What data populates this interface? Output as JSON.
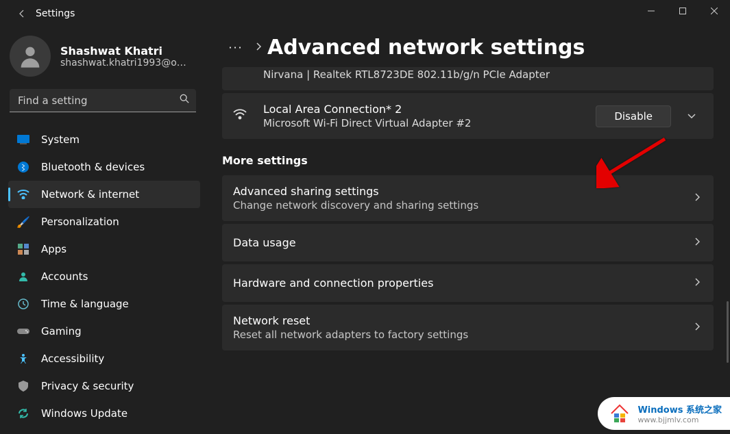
{
  "app_title": "Settings",
  "user": {
    "name": "Shashwat Khatri",
    "email": "shashwat.khatri1993@o…"
  },
  "search": {
    "placeholder": "Find a setting"
  },
  "sidebar": {
    "items": [
      {
        "label": "System",
        "icon": "💻",
        "selected": false
      },
      {
        "label": "Bluetooth & devices",
        "icon": "bt",
        "selected": false
      },
      {
        "label": "Network & internet",
        "icon": "wifi",
        "selected": true
      },
      {
        "label": "Personalization",
        "icon": "🖌️",
        "selected": false
      },
      {
        "label": "Apps",
        "icon": "apps",
        "selected": false
      },
      {
        "label": "Accounts",
        "icon": "👤",
        "selected": false
      },
      {
        "label": "Time & language",
        "icon": "🕒",
        "selected": false
      },
      {
        "label": "Gaming",
        "icon": "🎮",
        "selected": false
      },
      {
        "label": "Accessibility",
        "icon": "♿",
        "selected": false
      },
      {
        "label": "Privacy & security",
        "icon": "🛡️",
        "selected": false
      },
      {
        "label": "Windows Update",
        "icon": "🔄",
        "selected": false
      }
    ]
  },
  "breadcrumb": {
    "more": "···",
    "chevron": "›",
    "title": "Advanced network settings"
  },
  "adapters": [
    {
      "title": "",
      "sub": "Nirvana | Realtek RTL8723DE 802.11b/g/n PCIe Adapter",
      "button": "",
      "cropped": true
    },
    {
      "title": "Local Area Connection* 2",
      "sub": "Microsoft Wi-Fi Direct Virtual Adapter #2",
      "button": "Disable",
      "cropped": false
    }
  ],
  "more_settings_label": "More settings",
  "settings": [
    {
      "title": "Advanced sharing settings",
      "sub": "Change network discovery and sharing settings"
    },
    {
      "title": "Data usage",
      "sub": ""
    },
    {
      "title": "Hardware and connection properties",
      "sub": ""
    },
    {
      "title": "Network reset",
      "sub": "Reset all network adapters to factory settings"
    }
  ],
  "watermark": {
    "line1": "Windows 系统之家",
    "line2": "www.bjjmlv.com"
  }
}
